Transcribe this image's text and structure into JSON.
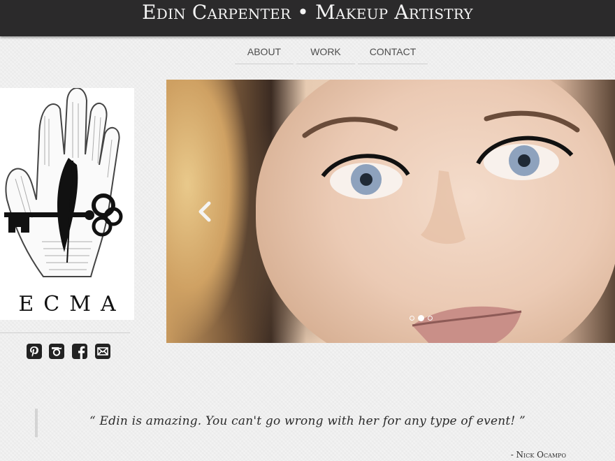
{
  "header": {
    "site_title": "Edin Carpenter • Makeup Artistry"
  },
  "nav": {
    "items": [
      {
        "label": "ABOUT"
      },
      {
        "label": "WORK"
      },
      {
        "label": "CONTACT"
      }
    ]
  },
  "sidebar": {
    "logo_text": "ECMA",
    "logo_icon": "hand-key-feather-logo",
    "social": [
      {
        "icon": "pinterest-icon"
      },
      {
        "icon": "instagram-icon"
      },
      {
        "icon": "facebook-icon"
      },
      {
        "icon": "email-icon"
      }
    ]
  },
  "slider": {
    "slide_count": 3,
    "active_slide": 2,
    "prev_icon": "chevron-left-icon"
  },
  "testimonial": {
    "quote": "“ Edin is amazing. You can't go wrong with her for any type of event! ”",
    "author": "- Nick Ocampo"
  }
}
